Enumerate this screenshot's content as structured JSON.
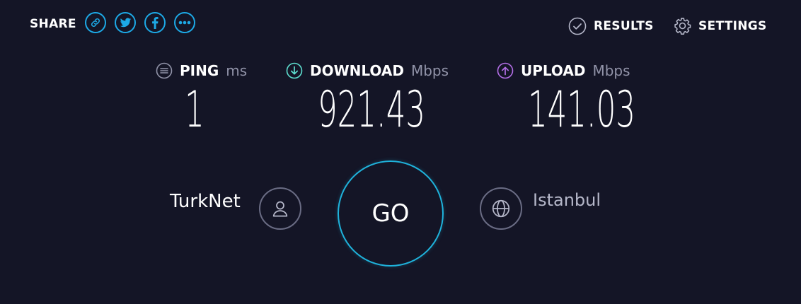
{
  "header": {
    "share_label": "SHARE",
    "share_buttons": [
      "link-icon",
      "twitter-icon",
      "facebook-icon",
      "more-icon"
    ],
    "results_label": "RESULTS",
    "settings_label": "SETTINGS"
  },
  "metrics": {
    "ping": {
      "label": "PING",
      "unit": "ms",
      "value": "1"
    },
    "download": {
      "label": "DOWNLOAD",
      "unit": "Mbps",
      "value": "921.43"
    },
    "upload": {
      "label": "UPLOAD",
      "unit": "Mbps",
      "value": "141.03"
    }
  },
  "connection": {
    "isp": "TurkNet",
    "server": "Istanbul"
  },
  "go_label": "GO",
  "colors": {
    "background": "#141526",
    "accent": "#1da9e6",
    "download": "#5ee0d0",
    "upload": "#b36ee6"
  }
}
